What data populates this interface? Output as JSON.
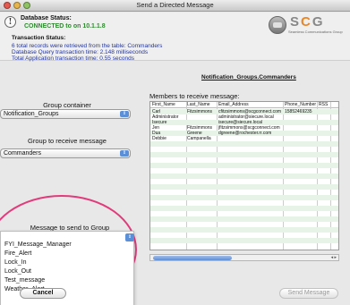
{
  "window": {
    "title": "Send a Directed Message"
  },
  "status": {
    "database_status_label": "Database Status:",
    "connection_text": "CONNECTED to on 10.1.1.8",
    "transaction_label": "Transaction Status:",
    "transaction_lines": [
      "6 total records were retrieved from the table: Commanders",
      "Database Query transaction time: 2.148 milliseconds",
      "Total Application transaction time: 0.55 seconds"
    ]
  },
  "logo": {
    "text_s": "S",
    "text_c": "C",
    "text_g": "G",
    "subtitle": "Seamless Communications Group"
  },
  "notification_hint": "Notification_Groups.Commanders",
  "group_container": {
    "label": "Group container",
    "value": "Notification_Groups"
  },
  "group_to_receive": {
    "label": "Group to receive message",
    "value": "Commanders"
  },
  "message_dropdown": {
    "label": "Message to send to Group",
    "options": [
      "FYI_Message_Manager",
      "Fire_Alert",
      "Lock_In",
      "Lock_Out",
      "Test_message",
      "Weather_Alert"
    ]
  },
  "members": {
    "label": "Members to receive message:",
    "columns": [
      "First_Name",
      "Last_Name",
      "Email_Address",
      "Phone_Number",
      "RSS"
    ],
    "rows": [
      [
        "Carl",
        "Fitzsimmons",
        "cfitzsimmons@scgconnect.com",
        "15852469235",
        ""
      ],
      [
        "Administrator",
        "",
        "administrator@siecure.local",
        "",
        ""
      ],
      [
        "Isecure",
        "",
        "isecure@siecure.local",
        "",
        ""
      ],
      [
        "Jen",
        "Fitzsimmons",
        "jfitzsimmons@scgconnect.com",
        "",
        ""
      ],
      [
        "Dua",
        "Greene",
        "dgreene@rochester.rr.com",
        "",
        ""
      ],
      [
        "Debbie",
        "Campanella",
        "",
        "",
        ""
      ]
    ]
  },
  "buttons": {
    "cancel": "Cancel",
    "send": "Send Message"
  },
  "colors": {
    "connected_green": "#2e8b2e",
    "status_blue": "#2436a0",
    "highlight_ring": "#e23b7c",
    "row_stripe": "#e7f3e7"
  }
}
